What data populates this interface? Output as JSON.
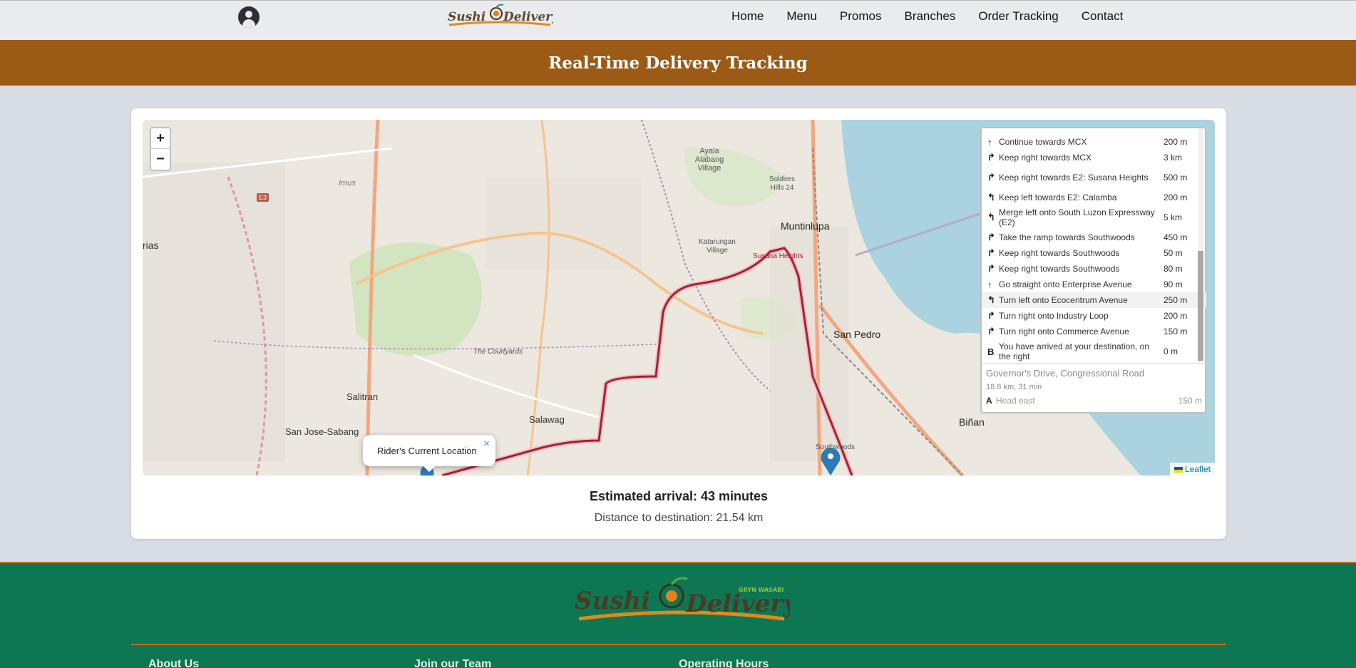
{
  "nav": {
    "logo_text": "Sushi Delivery",
    "links": [
      "Home",
      "Menu",
      "Promos",
      "Branches",
      "Order Tracking",
      "Contact"
    ]
  },
  "banner": {
    "title": "Real-Time Delivery Tracking"
  },
  "map": {
    "zoom_in": "+",
    "zoom_out": "−",
    "labels": [
      "Muntinlupa",
      "San Pedro",
      "Biñan",
      "Salitran",
      "San Jose-Sabang",
      "Salawag",
      "Ayala Alabang Village",
      "Soldiers Hills 24",
      "Katarungan Village",
      "Susana Heights",
      "The Courtyards",
      "Imus",
      "Southwoods",
      "rias",
      "E3"
    ],
    "popup": {
      "text": "Rider's Current Location",
      "close": "×"
    },
    "attribution": "Leaflet"
  },
  "route": {
    "steps": [
      {
        "icon": "straight",
        "text": "Continue towards MCX",
        "dist": "200 m"
      },
      {
        "icon": "right",
        "text": "Keep right towards MCX",
        "dist": "3 km"
      },
      {
        "icon": "right",
        "text": "Keep right towards E2: Susana Heights",
        "dist": "500 m"
      },
      {
        "icon": "left",
        "text": "Keep left towards E2: Calamba",
        "dist": "200 m"
      },
      {
        "icon": "left",
        "text": "Merge left onto South Luzon Expressway (E2)",
        "dist": "5 km"
      },
      {
        "icon": "right",
        "text": "Take the ramp towards Southwoods",
        "dist": "450 m"
      },
      {
        "icon": "right",
        "text": "Keep right towards Southwoods",
        "dist": "50 m"
      },
      {
        "icon": "right",
        "text": "Keep right towards Southwoods",
        "dist": "80 m"
      },
      {
        "icon": "straight",
        "text": "Go straight onto Enterprise Avenue",
        "dist": "90 m"
      },
      {
        "icon": "left",
        "text": "Turn left onto Ecocentrum Avenue",
        "dist": "250 m"
      },
      {
        "icon": "right",
        "text": "Turn right onto Industry Loop",
        "dist": "200 m"
      },
      {
        "icon": "right",
        "text": "Turn right onto Commerce Avenue",
        "dist": "150 m"
      },
      {
        "icon": "B",
        "text": "You have arrived at your destination, on the right",
        "dist": "0 m"
      }
    ],
    "alternative": {
      "name": "Governor's Drive, Congressional Road",
      "summary": "18.8 km, 31 min",
      "first_icon": "A",
      "first_text": "Head east",
      "first_dist": "150 m"
    }
  },
  "tracking": {
    "eta": "Estimated arrival: 43 minutes",
    "distance": "Distance to destination: 21.54 km"
  },
  "footer": {
    "logo_text": "Sushi Delivery",
    "logo_tag": "GRYN WASABI",
    "columns": [
      "About Us",
      "Join our Team",
      "Operating Hours"
    ]
  },
  "colors": {
    "banner": "#9b5a16",
    "footer": "#0d7653",
    "accent": "#c8701c",
    "route_line": "#b01c2e"
  }
}
